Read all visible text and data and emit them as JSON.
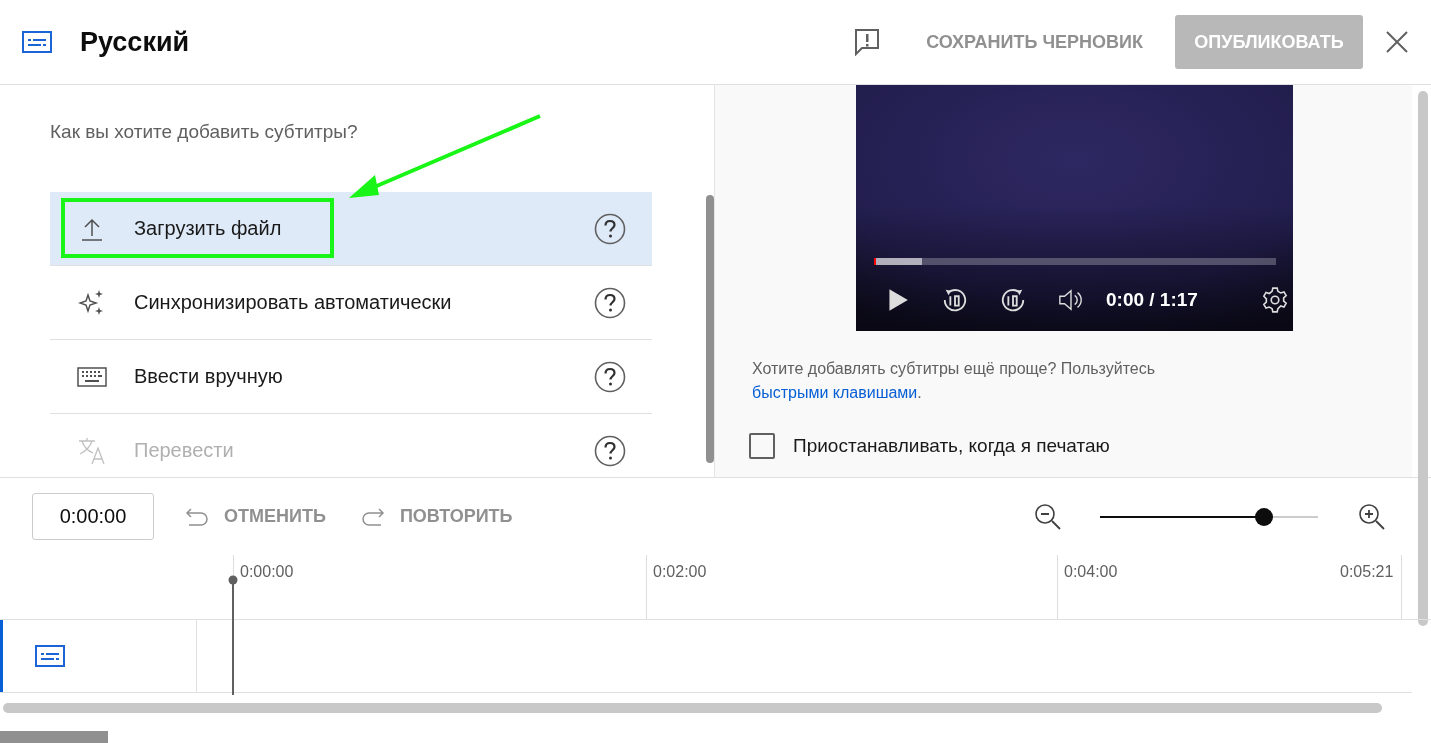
{
  "header": {
    "title": "Русский",
    "save_draft": "СОХРАНИТЬ ЧЕРНОВИК",
    "publish": {
      "label": "ОПУБЛИКОВАТЬ",
      "disabled": true
    }
  },
  "method_panel": {
    "question": "Как вы хотите добавить субтитры?",
    "options": [
      {
        "label": "Загрузить файл",
        "selected": true,
        "disabled": false
      },
      {
        "label": "Синхронизировать автоматически",
        "selected": false,
        "disabled": false
      },
      {
        "label": "Ввести вручную",
        "selected": false,
        "disabled": false
      },
      {
        "label": "Перевести",
        "selected": false,
        "disabled": true
      }
    ]
  },
  "player": {
    "progress": {
      "level": 0.12
    },
    "time": "0:00 / 1:17",
    "tip": "Хотите добавлять субтитры ещё проще? Пользуйтесь",
    "tip_link": "быстрыми клавишами",
    "tip_end": ".",
    "pause_checkbox": {
      "label": "Приостанавливать, когда я печатаю",
      "checked": false
    }
  },
  "toolbar": {
    "timecode": "0:00:00",
    "undo": "ОТМЕНИТЬ",
    "redo": "ПОВТОРИТЬ",
    "zoom": {
      "level": 0.75
    }
  },
  "timeline": {
    "ticks": [
      "0:00:00",
      "0:02:00",
      "0:04:00",
      "0:05:21"
    ]
  }
}
